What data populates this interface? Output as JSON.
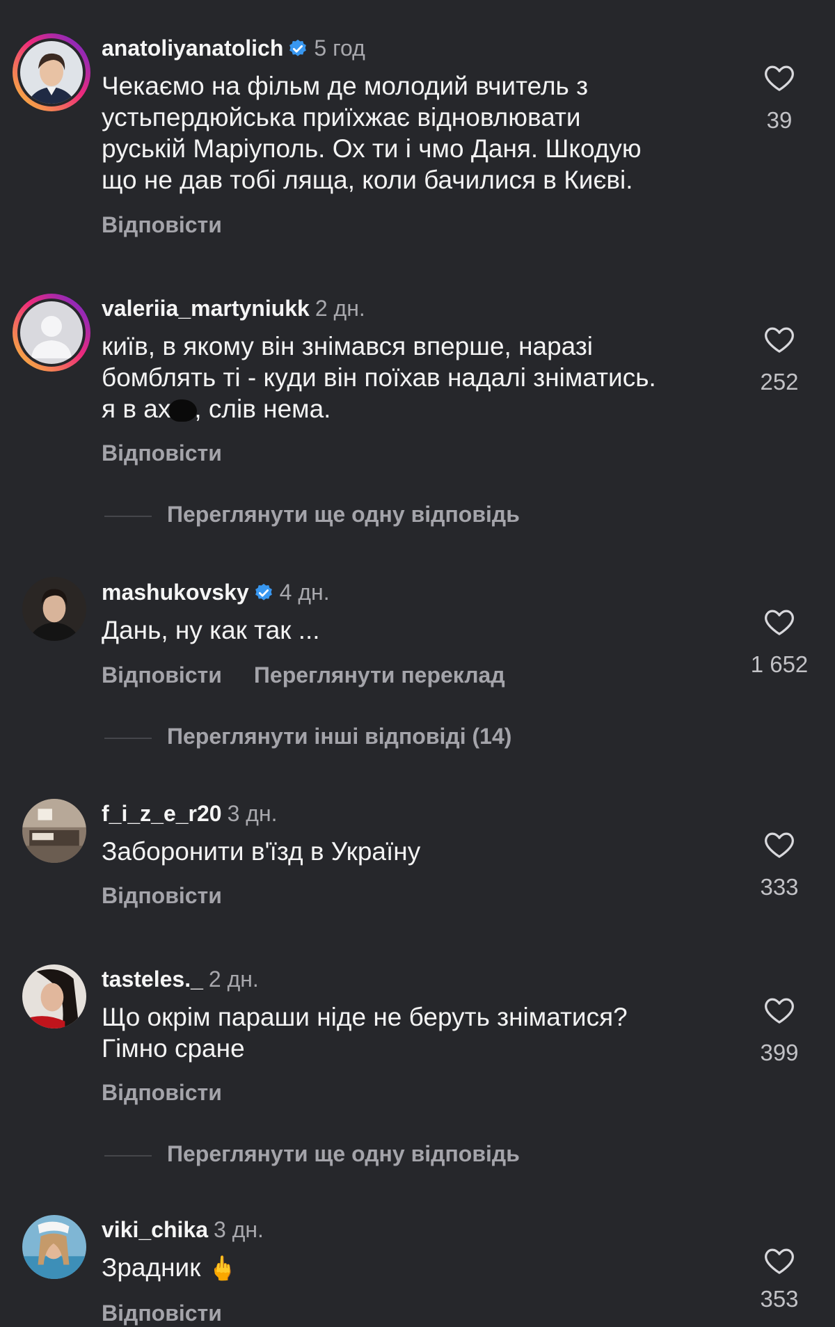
{
  "colors": {
    "background": "#26272b",
    "text": "#f3f3f3",
    "muted": "#a4a4aa",
    "verified": "#3897f0"
  },
  "comments": [
    {
      "username": "anatoliyanatolich",
      "verified": true,
      "time": "5 год",
      "text": "Чекаємо на фільм де молодий вчитель з\nустьпердюйська приїхжає відновлювати\nруській Маріуполь. Ох ти і чмо Даня. Шкодую\nщо не дав тобі ляща, коли бачилися в Києві.",
      "reply_label": "Відповісти",
      "likes": "39"
    },
    {
      "username": "valeriia_martyniukk",
      "verified": false,
      "time": "2 дн.",
      "text_part1": "київ, в якому він знімався вперше, наразі\nбомблять ті - куди він поїхав надалі зніматись.\nя в ах",
      "text_part2": ", слів нема.",
      "reply_label": "Відповісти",
      "likes": "252",
      "more_replies": "Переглянути ще одну відповідь"
    },
    {
      "username": "mashukovsky",
      "verified": true,
      "time": "4 дн.",
      "text": "Дань, ну как так ...",
      "reply_label": "Відповісти",
      "translate_label": "Переглянути переклад",
      "likes": "1 652",
      "more_replies": "Переглянути інші відповіді (14)"
    },
    {
      "username": "f_i_z_e_r20",
      "verified": false,
      "time": "3 дн.",
      "text": "Заборонити в'їзд в Україну",
      "reply_label": "Відповісти",
      "likes": "333"
    },
    {
      "username": "tasteles._",
      "verified": false,
      "time": "2 дн.",
      "text": "Що окрім параши ніде не беруть зніматися?\nГімно сране",
      "reply_label": "Відповісти",
      "likes": "399",
      "more_replies": "Переглянути ще одну відповідь"
    },
    {
      "username": "viki_chika",
      "verified": false,
      "time": "3 дн.",
      "text": "Зрадник ",
      "emoji": "🖕",
      "reply_label": "Відповісти",
      "likes": "353"
    }
  ],
  "icons": {
    "like": "heart-outline-icon",
    "verified": "verified-badge-icon"
  }
}
